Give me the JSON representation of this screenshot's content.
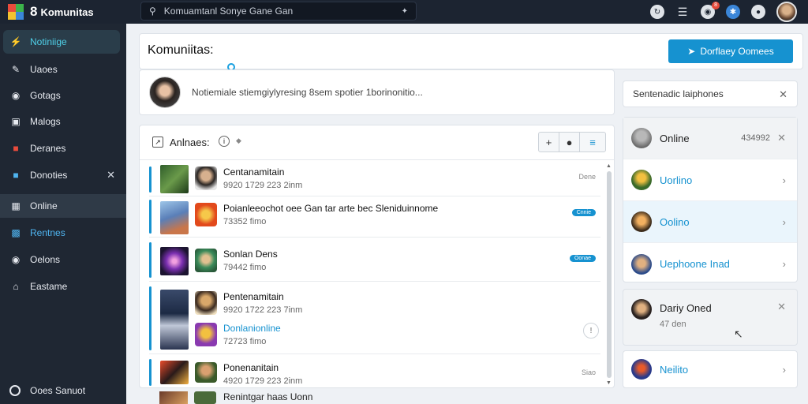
{
  "app": {
    "title": "Komunitas"
  },
  "search": {
    "value": "Komuamtanl Sonye Gane Gan"
  },
  "topbar": {
    "badge_count": "8"
  },
  "sidebar": {
    "items": [
      {
        "label": "Notiniige",
        "icon": "feed-icon"
      },
      {
        "label": "Uaoes",
        "icon": "pen-icon"
      },
      {
        "label": "Gotags",
        "icon": "gamepad-icon"
      },
      {
        "label": "Malogs",
        "icon": "bookmark-icon"
      },
      {
        "label": "Deranes",
        "icon": "archive-icon"
      },
      {
        "label": "Donoties",
        "icon": "folder-icon"
      },
      {
        "label": "Online",
        "icon": "grid-icon"
      },
      {
        "label": "Rentnes",
        "icon": "chart-icon"
      },
      {
        "label": "Oelons",
        "icon": "globe-icon"
      },
      {
        "label": "Eastame",
        "icon": "home-icon"
      }
    ],
    "bottom": "Ooes Sanuot"
  },
  "header": {
    "title": "Komuniitas:",
    "button_label": "Dorflaey Oomees"
  },
  "composer": {
    "placeholder": "Notiemiale stiemgiylyresing 8sem spotier 1borinonitio..."
  },
  "list": {
    "title": "Anlnaes:",
    "toolbar": {
      "add": "+",
      "record": "●",
      "menu": "≡"
    },
    "groups": [
      {
        "rows": [
          {
            "title": "Centanamitain",
            "sub": "9920 1729 223 2inm",
            "meta": "Dene",
            "title_blue": false
          }
        ]
      },
      {
        "rows": [
          {
            "title": "Poianleeochot oee Gan tar arte bec Sleniduinnome",
            "sub": "73352 fimo",
            "pill": "Cnnie",
            "title_blue": false
          }
        ]
      },
      {
        "rows": [
          {
            "title": "Sonlan Dens",
            "sub": "79442 fimo",
            "pill": "Oonae",
            "title_blue": false
          }
        ]
      },
      {
        "rows": [
          {
            "title": "Pentenamitain",
            "sub": "9920 1722 223 7inm",
            "title_blue": false
          },
          {
            "title": "Donlanionline",
            "sub": "72723 fimo",
            "title_blue": true
          }
        ]
      },
      {
        "rows": [
          {
            "title": "Ponenanitain",
            "sub": "4920 1729 223 2inm",
            "meta": "Siao",
            "title_blue": false
          }
        ]
      }
    ],
    "below_row": "Renintgar haas Uonn"
  },
  "right": {
    "search": "Sentenadic laiphones",
    "contacts_a": [
      {
        "name": "Online",
        "num": "434992",
        "dark": true
      },
      {
        "name": "Uorlino",
        "dark": false
      },
      {
        "name": "Oolino",
        "dark": false
      },
      {
        "name": "Uephoone Inad",
        "dark": false
      }
    ],
    "contacts_b": [
      {
        "name": "Dariy Oned",
        "sub": "47 den"
      }
    ],
    "contacts_c": [
      {
        "name": "Neilito"
      }
    ]
  },
  "colors": {
    "accent": "#1692d0",
    "topbar": "#1c2431",
    "sidebar": "#1f2733"
  }
}
